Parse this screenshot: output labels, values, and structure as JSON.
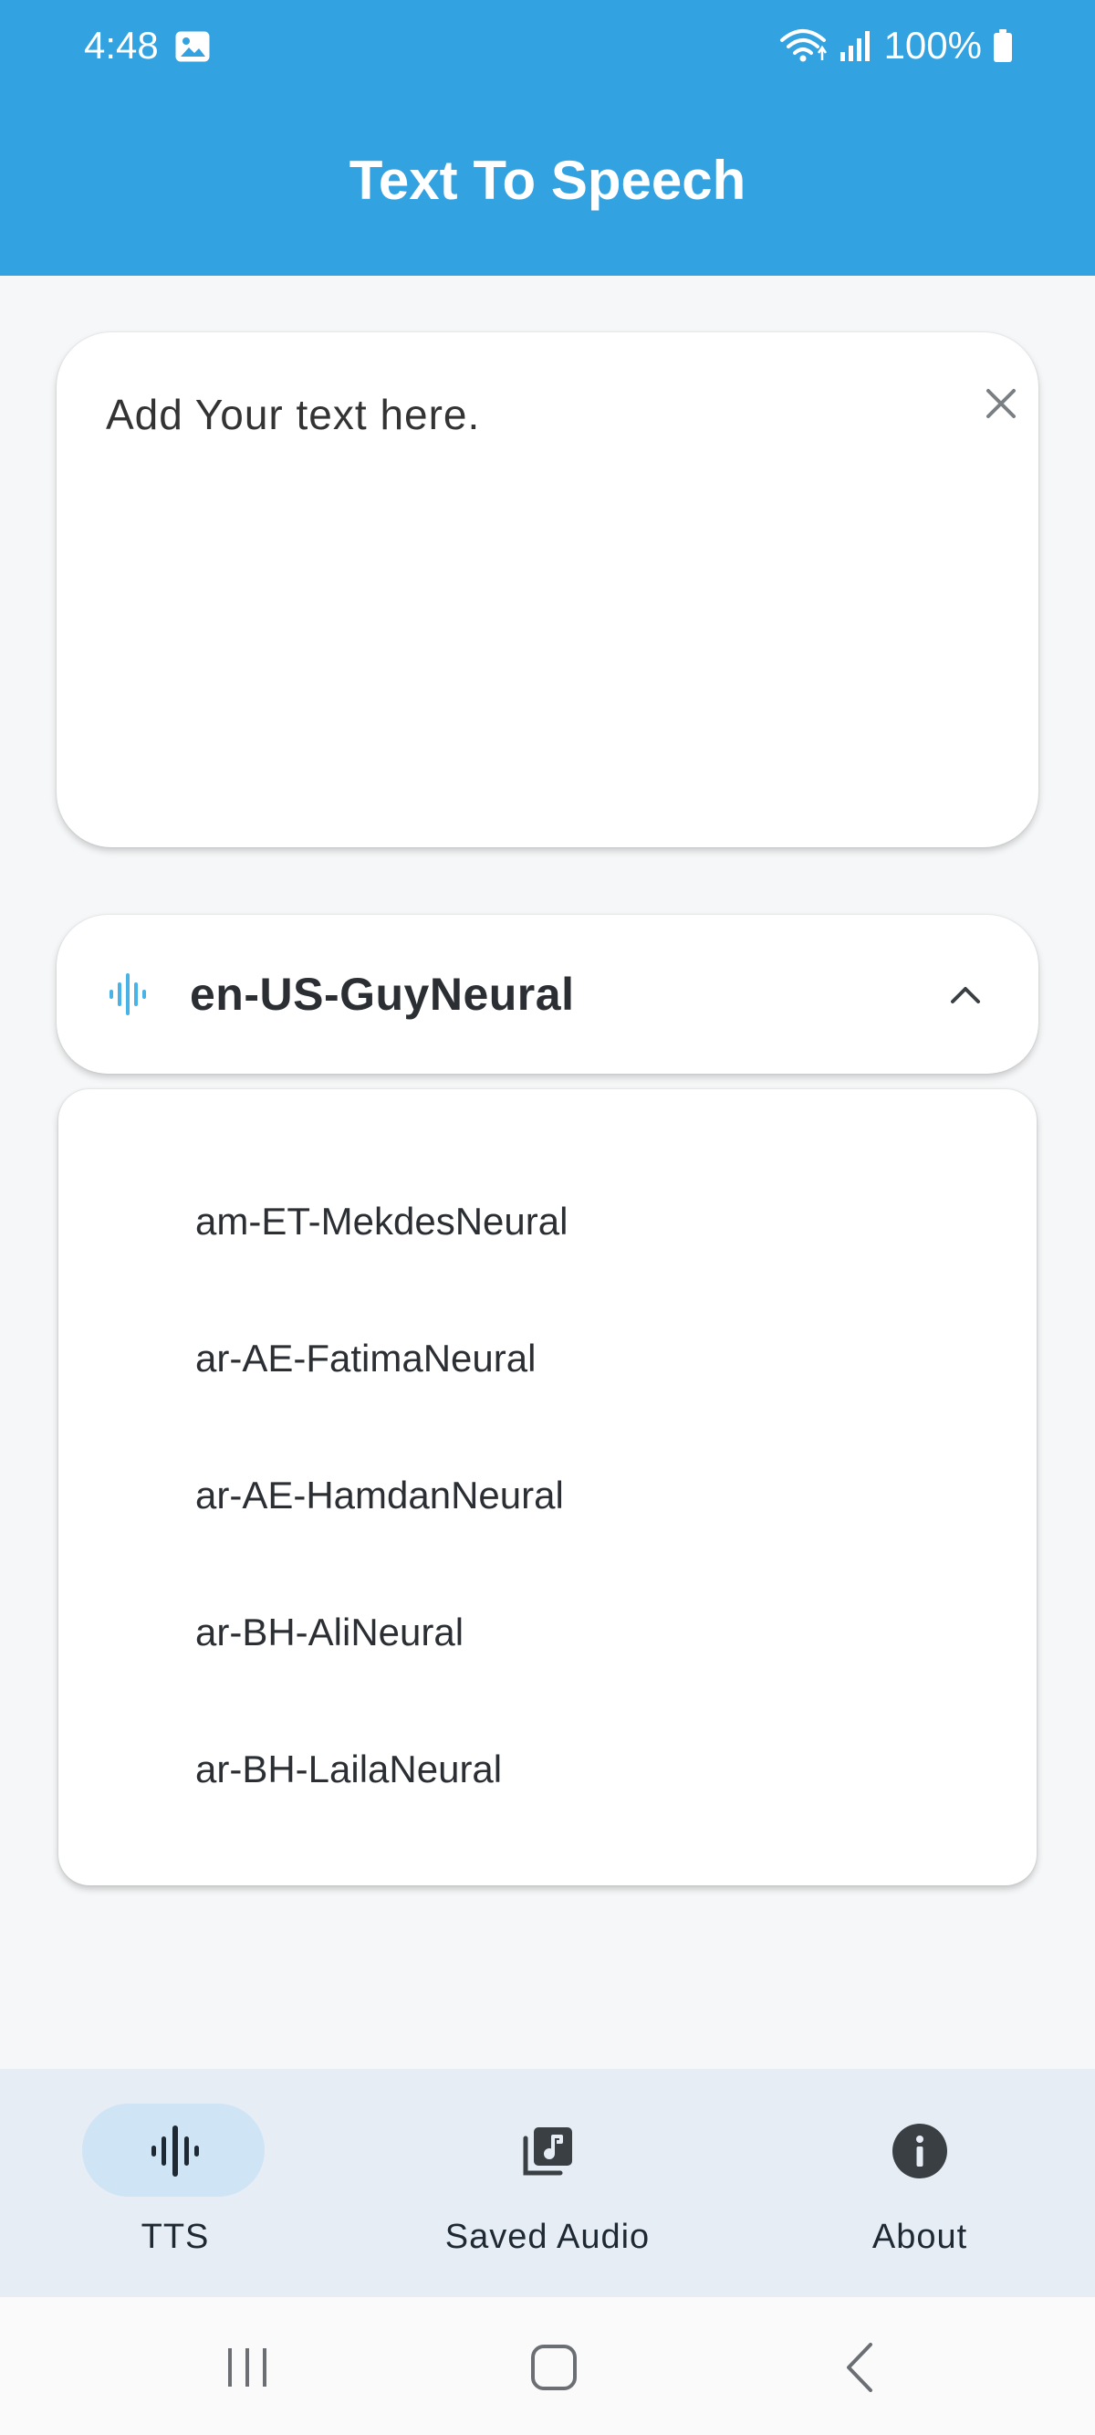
{
  "status_bar": {
    "time": "4:48",
    "battery": "100%"
  },
  "header": {
    "title": "Text To Speech"
  },
  "text_input": {
    "placeholder": "Add Your text here.",
    "value": ""
  },
  "voice_selector": {
    "selected": "en-US-GuyNeural",
    "expanded": true
  },
  "voice_options": [
    "am-ET-MekdesNeural",
    "ar-AE-FatimaNeural",
    "ar-AE-HamdanNeural",
    "ar-BH-AliNeural",
    "ar-BH-LailaNeural"
  ],
  "bottom_nav": {
    "items": [
      {
        "label": "TTS",
        "icon": "waveform-icon",
        "active": true
      },
      {
        "label": "Saved Audio",
        "icon": "music-library-icon",
        "active": false
      },
      {
        "label": "About",
        "icon": "info-icon",
        "active": false
      }
    ]
  },
  "colors": {
    "header": "#33a2e0",
    "accent": "#4ab3e6",
    "background": "#f5f7f8",
    "nav_background": "#e6edf5",
    "nav_active_pill": "#cfe4f5",
    "text_dark": "#2b2f33"
  },
  "icons": {
    "status_left": "image-icon",
    "status_right": [
      "wifi-icon",
      "signal-icon",
      "battery-icon"
    ],
    "clear": "close-icon",
    "voice": "waveform-icon",
    "dropdown": "chevron-up-icon",
    "system_nav": [
      "recent-apps-icon",
      "home-icon",
      "back-icon"
    ]
  }
}
